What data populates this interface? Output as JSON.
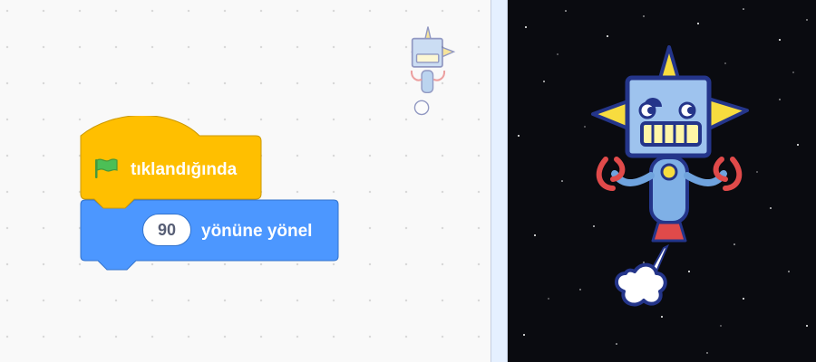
{
  "script": {
    "hat_block": {
      "label": "tıklandığında",
      "icon": "green-flag-icon",
      "color": "#ffbf00"
    },
    "motion_block": {
      "value": "90",
      "label": "yönüne yönel",
      "color": "#4c97ff"
    }
  },
  "stage": {
    "backdrop": "space-starfield",
    "sprite": "robot-sprite"
  },
  "colors": {
    "hat_block": "#ffbf00",
    "motion_block": "#4c97ff",
    "code_area_bg": "#f9f9f9",
    "stage_bg": "#0a0b10"
  }
}
